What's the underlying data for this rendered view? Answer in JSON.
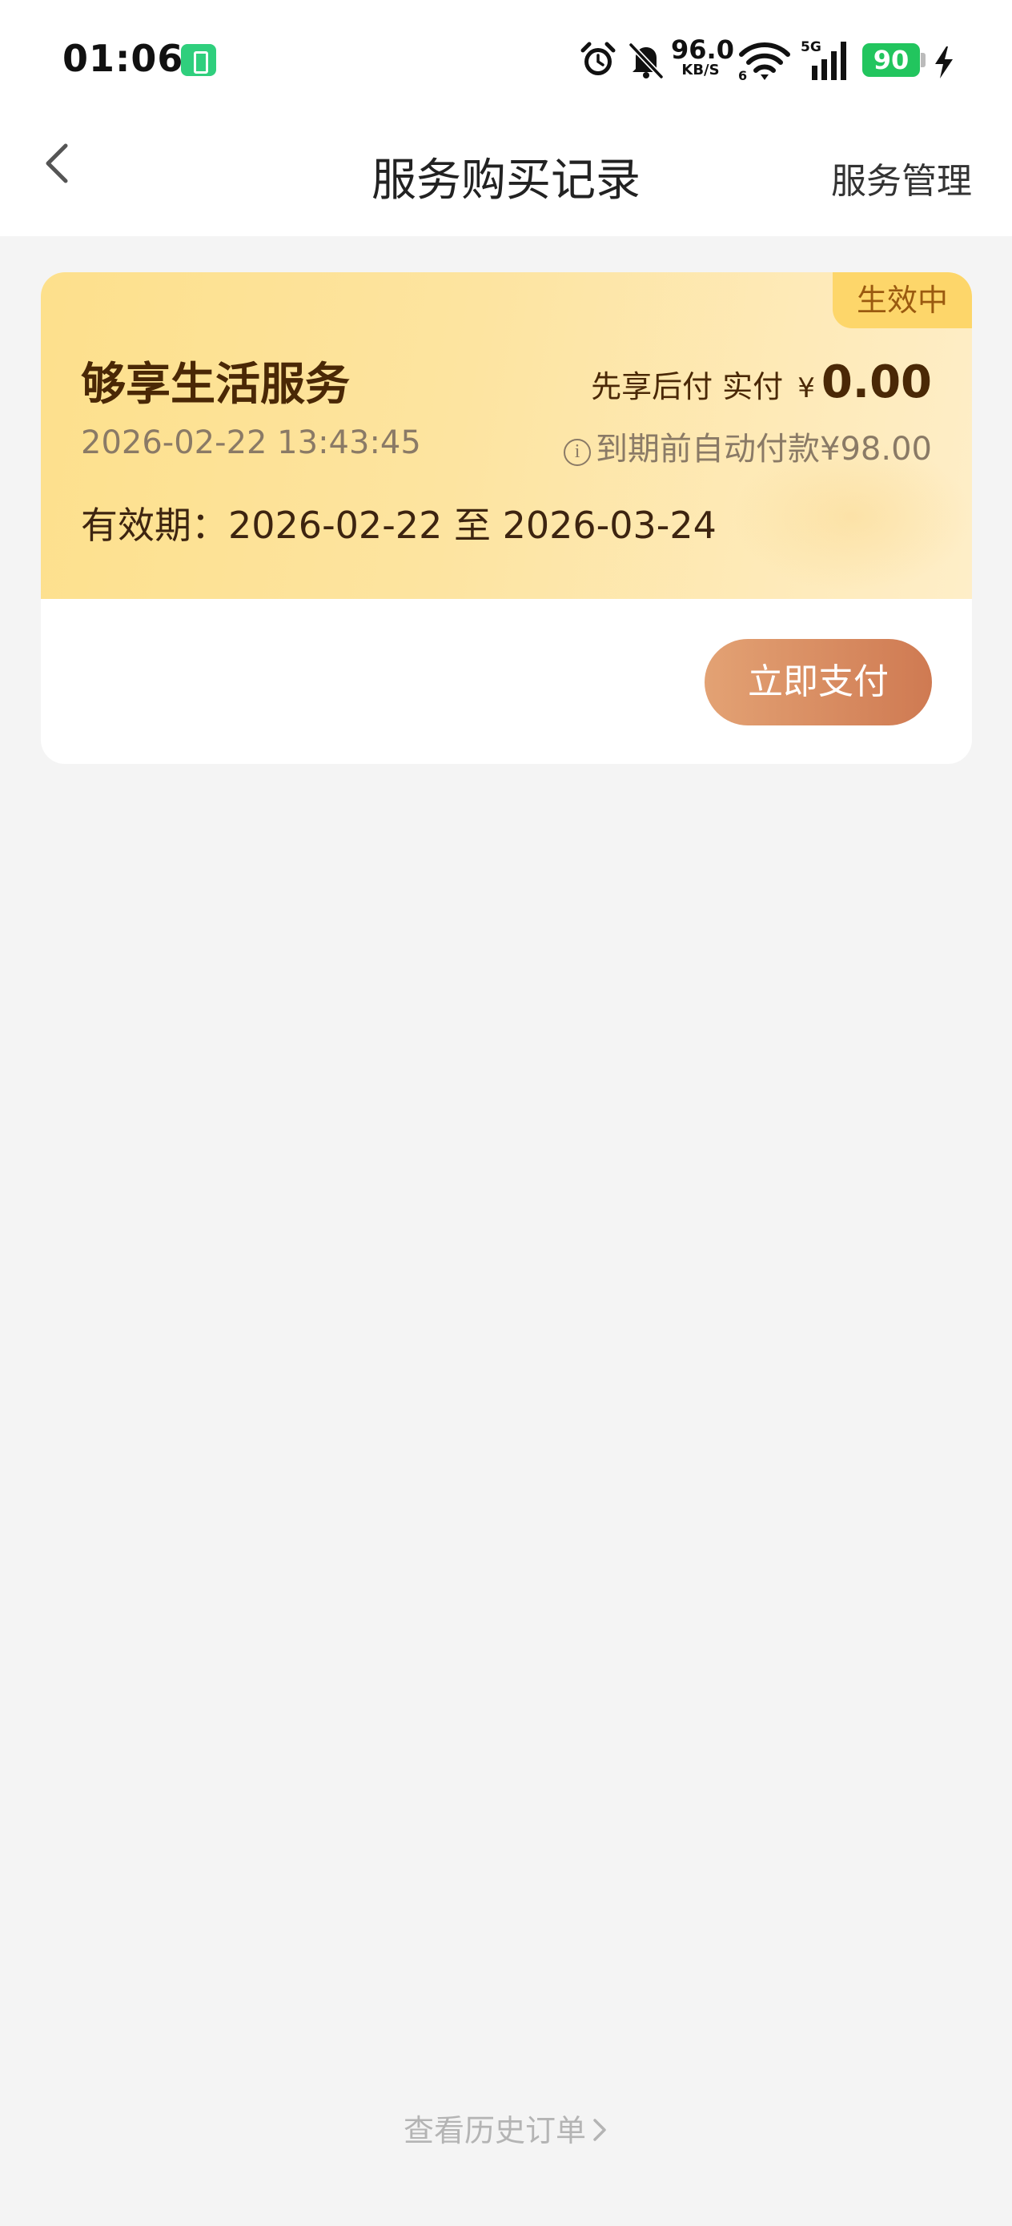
{
  "status_bar": {
    "time": "01:06",
    "net_speed": "96.0",
    "net_speed_unit": "KB/S",
    "network": "5G",
    "battery": "90",
    "icons": [
      "battery-saver-icon",
      "alarm-icon",
      "bell-off-icon",
      "wifi-icon",
      "signal-icon",
      "charging-icon"
    ]
  },
  "nav": {
    "title": "服务购买记录",
    "action": "服务管理"
  },
  "card": {
    "status": "生效中",
    "service_name": "够享生活服务",
    "order_time": "2026-02-22 13:43:45",
    "price_label": "先享后付 实付",
    "currency": "¥",
    "amount": "0.00",
    "autopay_note": "到期前自动付款¥98.00",
    "validity": "有效期：2026-02-22 至 2026-03-24",
    "pay_button": "立即支付"
  },
  "footer": {
    "history_link": "查看历史订单"
  },
  "colors": {
    "card_gradient_start": "#fde08c",
    "badge": "#fdd66a",
    "button_start": "#e3a274",
    "button_end": "#cf7a52",
    "battery": "#22c55e"
  }
}
